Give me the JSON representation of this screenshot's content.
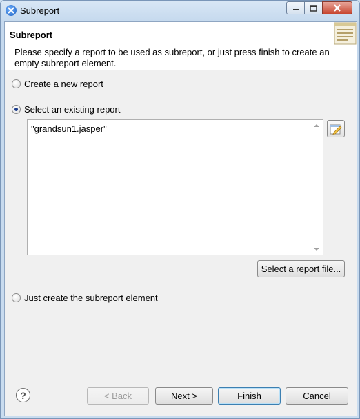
{
  "window": {
    "title": "Subreport"
  },
  "header": {
    "title": "Subreport",
    "description": "Please specify a report to be used as subreport, or just press finish to create an empty subreport element."
  },
  "options": {
    "create_new": "Create a new report",
    "select_existing": "Select an existing report",
    "just_create": "Just create the subreport element",
    "selected": "select_existing"
  },
  "expression": {
    "value": "\"grandsun1.jasper\""
  },
  "buttons": {
    "select_file": "Select a report file...",
    "back": "< Back",
    "next": "Next >",
    "finish": "Finish",
    "cancel": "Cancel",
    "help": "?"
  },
  "icons": {
    "app": "eclipse-icon",
    "banner": "wizard-banner-icon",
    "edit": "expression-editor-icon"
  }
}
